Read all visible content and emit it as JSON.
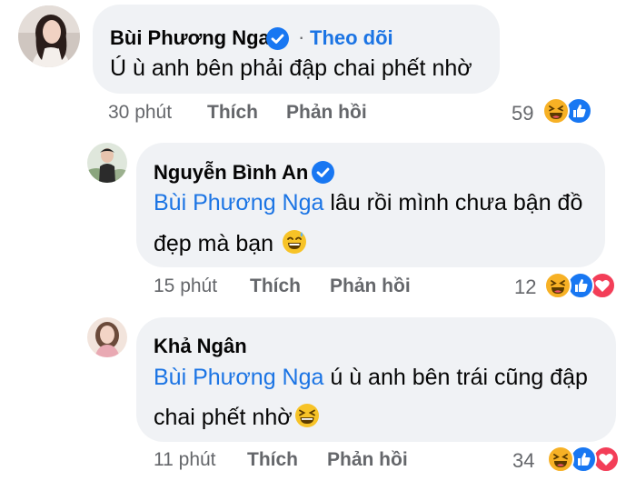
{
  "comments": [
    {
      "author": "Bùi Phương Nga",
      "verified": true,
      "follow_label": "Theo dõi",
      "separator": "·",
      "line1": "Ú ù anh bên phải đập chai phết nhờ",
      "time": "30 phút",
      "like_label": "Thích",
      "reply_label": "Phản hồi",
      "reaction_count": "59",
      "reactions": [
        "haha-icon",
        "like-icon"
      ]
    },
    {
      "author": "Nguyễn Bình An",
      "verified": true,
      "mention": "Bùi Phương Nga",
      "line1_rest": " lâu rồi mình chưa bận đồ",
      "line2": "đẹp mà bạn",
      "line2_emoji": "sweat-smile-emoji-icon",
      "time": "15 phút",
      "like_label": "Thích",
      "reply_label": "Phản hồi",
      "reaction_count": "12",
      "reactions": [
        "haha-icon",
        "like-icon",
        "love-icon"
      ]
    },
    {
      "author": "Khả Ngân",
      "verified": false,
      "mention": "Bùi Phương Nga",
      "line1_rest": " ú ù anh bên trái cũng đập",
      "line2": "chai phết nhờ",
      "line2_emoji": "laughing-emoji-icon",
      "time": "11 phút",
      "like_label": "Thích",
      "reply_label": "Phản hồi",
      "reaction_count": "34",
      "reactions": [
        "haha-icon",
        "like-icon",
        "love-icon"
      ]
    }
  ],
  "colors": {
    "bubble": "#f0f2f5",
    "link_blue": "#1b74e4",
    "meta_gray": "#65676b",
    "like_blue": "#1877f2",
    "love_red": "#f33e58",
    "haha_yellow": "#f7b125"
  }
}
